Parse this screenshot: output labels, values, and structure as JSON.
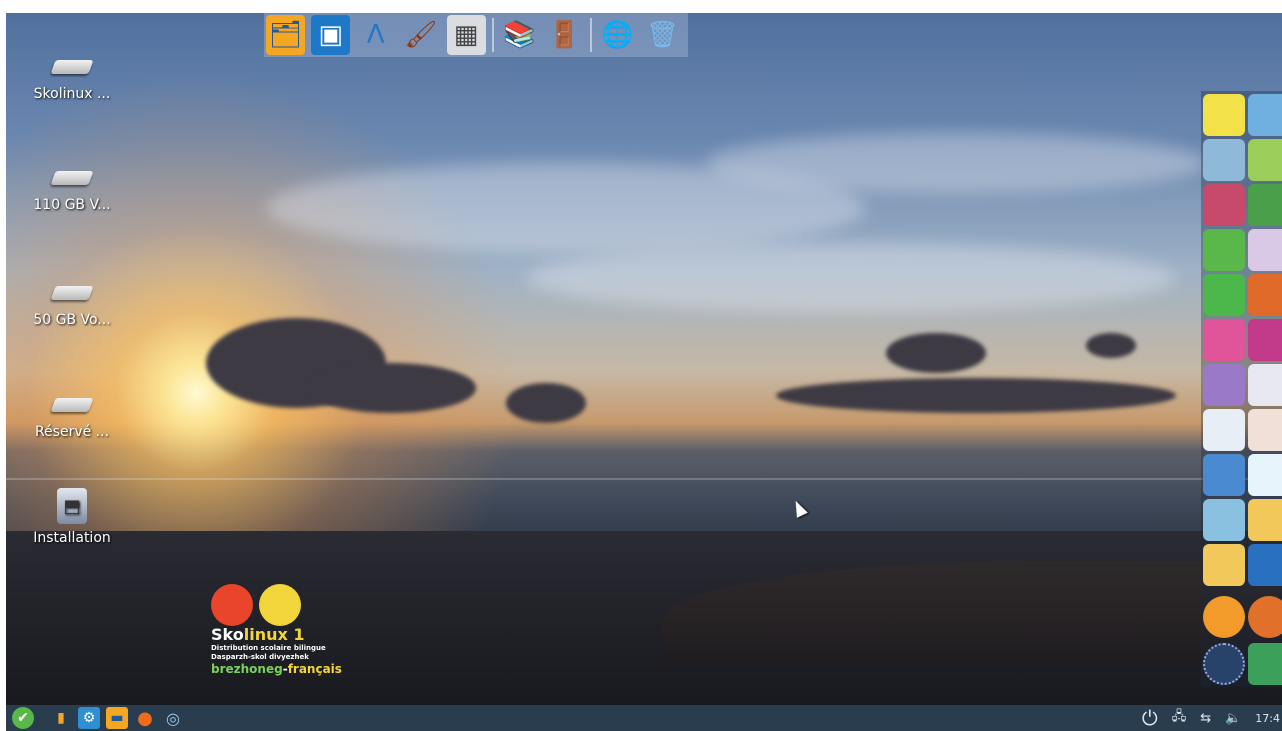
{
  "desktop": {
    "icons": [
      {
        "label": "Skolinux ...",
        "icon": "drive-icon"
      },
      {
        "label": "110 GB V...",
        "icon": "drive-icon"
      },
      {
        "label": "50 GB Vo...",
        "icon": "drive-icon"
      },
      {
        "label": "Réservé ...",
        "icon": "drive-icon"
      },
      {
        "label": "Installation",
        "icon": "installer-icon"
      }
    ]
  },
  "top_dock": {
    "items": [
      {
        "name": "file-manager-icon",
        "glyph": "🗂"
      },
      {
        "name": "office-icon",
        "glyph": "▣"
      },
      {
        "name": "vector-draw-icon",
        "glyph": "Λ"
      },
      {
        "name": "paint-brush-icon",
        "glyph": "🖌"
      },
      {
        "name": "calculator-icon",
        "glyph": "▦"
      },
      {
        "name": "books-icon",
        "glyph": "📚"
      },
      {
        "name": "exit-door-icon",
        "glyph": "🚪"
      },
      {
        "name": "translate-globe-icon",
        "glyph": "🌐"
      },
      {
        "name": "trash-icon",
        "glyph": "🗑"
      }
    ]
  },
  "logo": {
    "title_prefix": "Sko",
    "title_suffix": "linux 1",
    "line1": "Distribution scolaire bilingue",
    "line2": "Dasparzh-skol divyezhek",
    "lang_br": "brezhoneg",
    "lang_sep": "-",
    "lang_fr": "français"
  },
  "taskbar": {
    "apps": [
      {
        "name": "start-menu-icon",
        "glyph": "✔"
      },
      {
        "name": "panel-folder-icon",
        "glyph": "▮"
      },
      {
        "name": "settings-gear-icon",
        "glyph": "⚙"
      },
      {
        "name": "folder-icon",
        "glyph": "▬"
      },
      {
        "name": "firefox-icon",
        "glyph": "●"
      },
      {
        "name": "browser-icon",
        "glyph": "◎"
      }
    ],
    "tray": {
      "power": "⏻",
      "network": "🖧",
      "volume": "🔈",
      "clock": "17:4"
    }
  },
  "colors": {
    "taskbar_bg": "#2a3d4e",
    "accent": "#2f8fd0"
  }
}
